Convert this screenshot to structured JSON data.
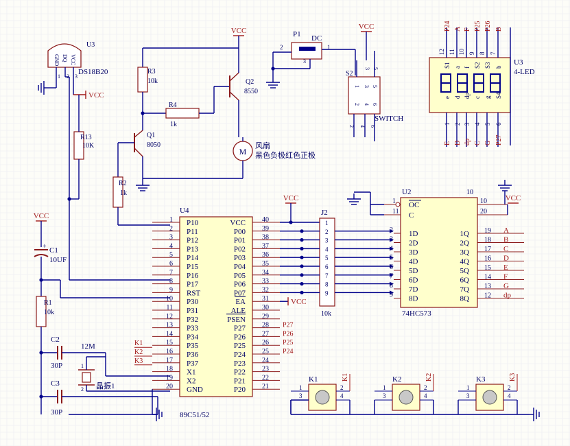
{
  "palette": {
    "paper": "#fdfdf8",
    "grid": "#e9eaf2",
    "wire": "#00008a",
    "part": "#8b1a1a",
    "body": "#ffffcc",
    "text": "#000066",
    "red": "#a01818",
    "dot": "#00008a"
  },
  "u3s": {
    "des": "U3",
    "name": "DS18B20",
    "pins": [
      "GND",
      "DQ",
      "VCC"
    ],
    "nums": [
      "1",
      "2",
      "3"
    ]
  },
  "vcc": "VCC",
  "q1": {
    "des": "Q1",
    "val": "8050"
  },
  "q2": {
    "des": "Q2",
    "val": "8550"
  },
  "r1": {
    "des": "R1",
    "val": "10k"
  },
  "r2": {
    "des": "R2",
    "val": "1k"
  },
  "r3": {
    "des": "R3",
    "val": "10k"
  },
  "r4": {
    "des": "R4",
    "val": "1k"
  },
  "r13": {
    "des": "R13",
    "val": "10K"
  },
  "c1": {
    "des": "C1",
    "val": "10UF",
    "plus": "+"
  },
  "c2": {
    "des": "C2",
    "val": "30P"
  },
  "c3": {
    "des": "C3",
    "val": "30P"
  },
  "xtal": {
    "des": "12M",
    "val": "晶振1",
    "pins": [
      "1",
      "2"
    ]
  },
  "motor": {
    "des": "M",
    "l1": "风扇",
    "l2": "黑色负极红色正极"
  },
  "p1": {
    "des": "P1",
    "val": "DC",
    "n2": "2",
    "n1": "1",
    "n3": "3"
  },
  "sw": {
    "des": "S2",
    "val": "SWITCH",
    "top": [
      "3",
      "5"
    ],
    "bot": [
      "2",
      "4",
      "6"
    ],
    "mid": [
      "1",
      "3",
      "5"
    ]
  },
  "led": {
    "des": "U3",
    "val": "4-LED",
    "top": [
      "P24",
      "P25",
      "P26",
      "P27",
      "a",
      "b",
      "f",
      "P26"
    ],
    "topNum": [
      "12",
      "11",
      "10",
      "9",
      "8",
      "7"
    ],
    "topNames": [
      "P24",
      "A",
      "F",
      "P25",
      "P26",
      "B"
    ],
    "inner": [
      "S1",
      "a",
      "f",
      "S2",
      "S3",
      "b"
    ],
    "innerBot": [
      "e",
      "d",
      "dp",
      "c",
      "g",
      "S4"
    ],
    "botNum": [
      "1",
      "2",
      "3",
      "4",
      "5",
      "6"
    ],
    "botNames": [
      "E",
      "D",
      "dp",
      "C",
      "G",
      "P27"
    ]
  },
  "u4": {
    "des": "U4",
    "part": "89C51/52",
    "left": [
      [
        "1",
        "P10"
      ],
      [
        "2",
        "P11"
      ],
      [
        "3",
        "P12"
      ],
      [
        "4",
        "P13"
      ],
      [
        "5",
        "P14"
      ],
      [
        "6",
        "P15"
      ],
      [
        "7",
        "P16"
      ],
      [
        "8",
        "P17"
      ],
      [
        "9",
        "RST"
      ],
      [
        "10",
        "P30"
      ],
      [
        "11",
        "P31"
      ],
      [
        "12",
        "P32"
      ],
      [
        "13",
        "P33"
      ],
      [
        "14",
        "P34"
      ],
      [
        "15",
        "P35"
      ],
      [
        "16",
        "P36"
      ],
      [
        "17",
        "P37"
      ],
      [
        "18",
        "X1"
      ],
      [
        "19",
        "X2"
      ],
      [
        "20",
        "GND"
      ]
    ],
    "right": [
      [
        "40",
        "VCC"
      ],
      [
        "39",
        "P00"
      ],
      [
        "38",
        "P01"
      ],
      [
        "37",
        "P02"
      ],
      [
        "36",
        "P03"
      ],
      [
        "35",
        "P04"
      ],
      [
        "34",
        "P05"
      ],
      [
        "33",
        "P06"
      ],
      [
        "32",
        "P07"
      ],
      [
        "31",
        "EA"
      ],
      [
        "30",
        "ALE"
      ],
      [
        "29",
        "PSEN"
      ],
      [
        "28",
        "P27"
      ],
      [
        "27",
        "P26"
      ],
      [
        "26",
        "P25"
      ],
      [
        "25",
        "P24"
      ],
      [
        "24",
        "P23"
      ],
      [
        "23",
        "P22"
      ],
      [
        "22",
        "P21"
      ],
      [
        "21",
        "P20"
      ]
    ],
    "netR": [
      "P27",
      "P26",
      "P25",
      "P24"
    ],
    "netL": [
      "K1",
      "K2",
      "K3"
    ]
  },
  "j2": {
    "des": "J2",
    "val": "10k",
    "nums": [
      "1",
      "2",
      "3",
      "4",
      "5",
      "6",
      "7",
      "8",
      "9"
    ]
  },
  "u2": {
    "des": "U2",
    "part": "74HC573",
    "left": [
      [
        "1",
        "OC"
      ],
      [
        "11",
        "C"
      ],
      [
        "2",
        "1D"
      ],
      [
        "3",
        "2D"
      ],
      [
        "4",
        "3D"
      ],
      [
        "5",
        "4D"
      ],
      [
        "6",
        "5D"
      ],
      [
        "7",
        "6D"
      ],
      [
        "8",
        "7D"
      ],
      [
        "9",
        "8D"
      ]
    ],
    "right": [
      [
        "10",
        ""
      ],
      [
        "20",
        ""
      ],
      [
        "19",
        "1Q"
      ],
      [
        "18",
        "2Q"
      ],
      [
        "17",
        "3Q"
      ],
      [
        "16",
        "4Q"
      ],
      [
        "15",
        "5Q"
      ],
      [
        "14",
        "6Q"
      ],
      [
        "13",
        "7Q"
      ],
      [
        "12",
        "8Q"
      ]
    ],
    "outNets": [
      "A",
      "B",
      "C",
      "D",
      "E",
      "F",
      "G",
      "dp"
    ]
  },
  "keys": [
    {
      "des": "K1",
      "n1": "1",
      "n2": "2",
      "n3": "3",
      "n4": "4"
    },
    {
      "des": "K2",
      "n1": "1",
      "n2": "2",
      "n3": "3",
      "n4": "4"
    },
    {
      "des": "K3",
      "n1": "1",
      "n2": "2",
      "n3": "3",
      "n4": "4"
    }
  ]
}
